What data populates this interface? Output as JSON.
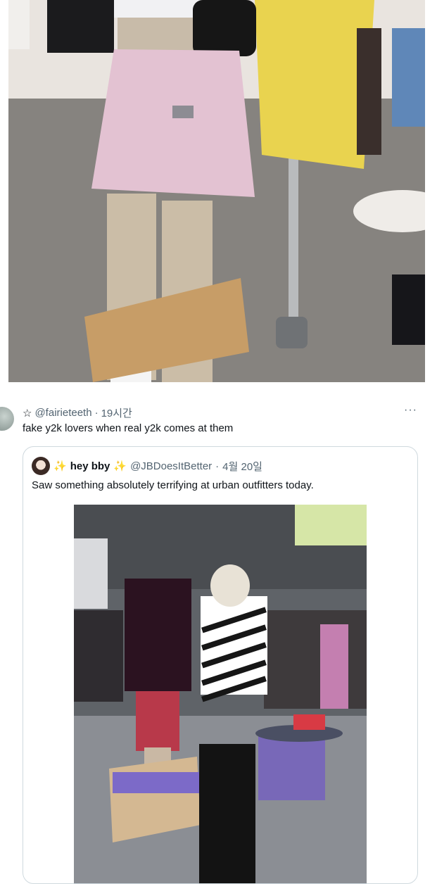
{
  "top_image": {
    "alt_subject": "mannequin-pink-skirt-photo"
  },
  "tweet": {
    "handle": "@fairieteeth",
    "separator": "·",
    "time": "19시간",
    "text": "fake y2k lovers when real y2k comes at them",
    "more": "···"
  },
  "quote": {
    "sparkle_left": "✨",
    "display_name": "hey bby",
    "sparkle_right": "✨",
    "handle": "@JBDoesItBetter",
    "separator": "·",
    "date": "4월 20일",
    "text": "Saw something absolutely terrifying at urban outfitters today."
  },
  "colors": {
    "text_primary": "#0f1419",
    "text_secondary": "#536471",
    "border": "#cfd9de",
    "sparkle": "#f5b62e"
  }
}
